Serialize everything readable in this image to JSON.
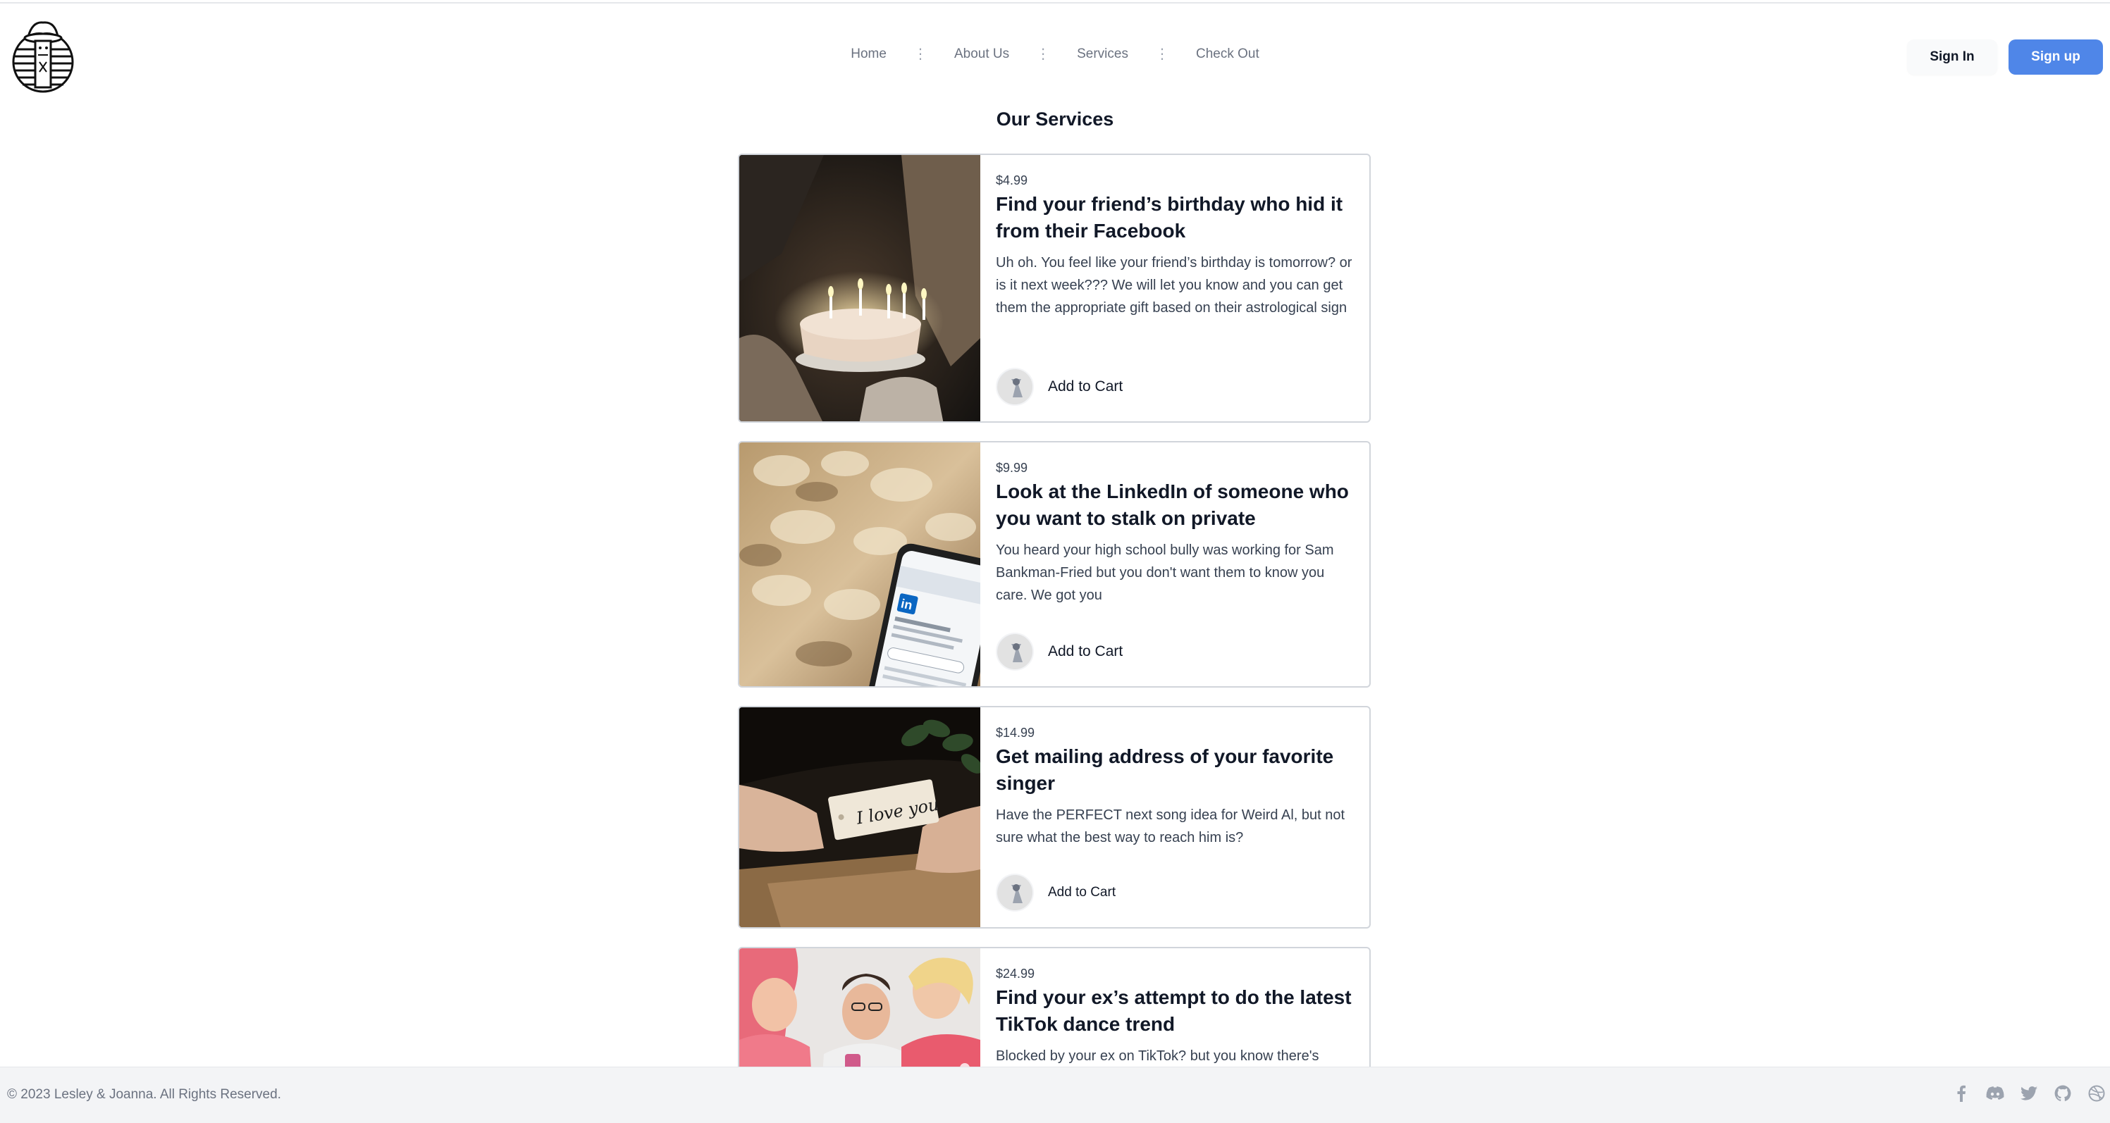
{
  "nav": {
    "items": [
      {
        "label": "Home"
      },
      {
        "label": "About Us"
      },
      {
        "label": "Services"
      },
      {
        "label": "Check Out"
      }
    ],
    "separator": "⋮"
  },
  "auth": {
    "sign_in": "Sign In",
    "sign_up": "Sign up"
  },
  "page": {
    "title": "Our Services"
  },
  "services": [
    {
      "price": "$4.99",
      "title": "Find your friend’s birthday who hid it from their Facebook",
      "description": "Uh oh. You feel like your friend’s birthday is tomorrow? or is it next week??? We will let you know and you can get them the appropriate gift based on their astrological sign",
      "cart_label": "Add to Cart"
    },
    {
      "price": "$9.99",
      "title": "Look at the LinkedIn of someone who you want to stalk on private",
      "description": "You heard your high school bully was working for Sam Bankman-Fried but you don't want them to know you care. We got you",
      "cart_label": "Add to Cart"
    },
    {
      "price": "$14.99",
      "title": "Get mailing address of your favorite singer",
      "description": "Have the PERFECT next song idea for Weird Al, but not sure what the best way to reach him is?",
      "cart_label": "Add to Cart"
    },
    {
      "price": "$24.99",
      "title": "Find your ex’s attempt to do the latest TikTok dance trend",
      "description": "Blocked by your ex on TikTok? but you know there's"
    }
  ],
  "images": {
    "card1_note": "I love you"
  },
  "footer": {
    "copyright": "© 2023 Lesley & Joanna. All Rights Reserved.",
    "social_icons": [
      "facebook-icon",
      "discord-icon",
      "twitter-icon",
      "github-icon",
      "dribbble-icon"
    ]
  },
  "colors": {
    "primary": "#4f86e8",
    "muted": "#6b7280",
    "footer_bg": "#f3f4f6"
  }
}
